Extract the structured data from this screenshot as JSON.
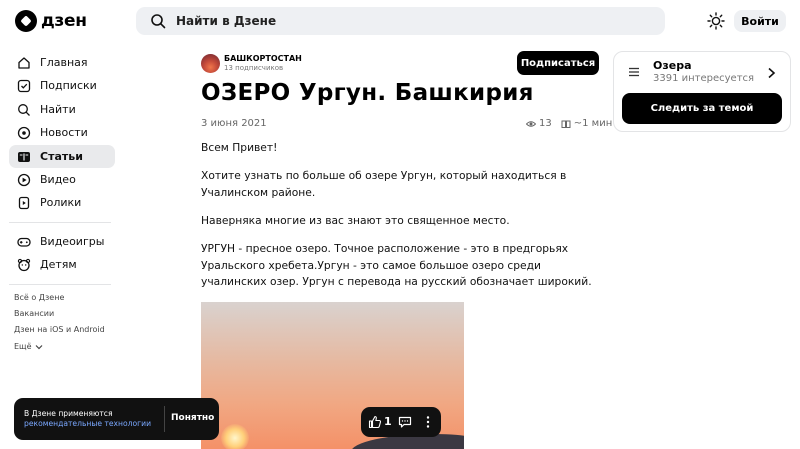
{
  "header": {
    "logo_text": "дзен",
    "search_placeholder": "Найти в Дзене",
    "login_label": "Войти"
  },
  "sidebar": {
    "items": [
      {
        "label": "Главная",
        "icon": "home-icon"
      },
      {
        "label": "Подписки",
        "icon": "subscriptions-icon"
      },
      {
        "label": "Найти",
        "icon": "search-icon"
      },
      {
        "label": "Новости",
        "icon": "news-icon"
      },
      {
        "label": "Статьи",
        "icon": "articles-icon",
        "active": true
      },
      {
        "label": "Видео",
        "icon": "video-icon"
      },
      {
        "label": "Ролики",
        "icon": "clips-icon"
      },
      {
        "label": "Видеоигры",
        "icon": "gamepad-icon"
      },
      {
        "label": "Детям",
        "icon": "kids-icon"
      }
    ],
    "footer": [
      "Всё о Дзене",
      "Вакансии",
      "Дзен на iOS и Android",
      "Ещё"
    ]
  },
  "article": {
    "channel_name": "БАШКОРТОСТАН",
    "channel_subs": "13 подписчиков",
    "subscribe_label": "Подписаться",
    "title": "ОЗЕРО Ургун. Башкирия",
    "date": "3 июня 2021",
    "views": "13",
    "read_time": "~1 мин",
    "paragraphs": [
      "Всем Привет!",
      "Хотите узнать по больше об озере Ургун, который находиться в Учалинском районе.",
      "Наверняка многие из вас знают это священное место.",
      "УРГУН - пресное озеро. Точное расположение - это в предгорьях Уральского хребета.Ургун - это самое большое озеро среди учалинских озер. Ургун с перевода на русский обозначает широкий."
    ]
  },
  "topic": {
    "name": "Озера",
    "count": "3391 интересуется",
    "follow_label": "Следить за темой"
  },
  "cookie": {
    "text": "В Дзене применяются",
    "link": "рекомендательные технологии",
    "ok_label": "Понятно"
  },
  "actions": {
    "like_count": "1"
  },
  "colors": {
    "accent_dark": "#000000",
    "active_bg": "#e9eaec",
    "link_blue": "#7aa8ff"
  }
}
